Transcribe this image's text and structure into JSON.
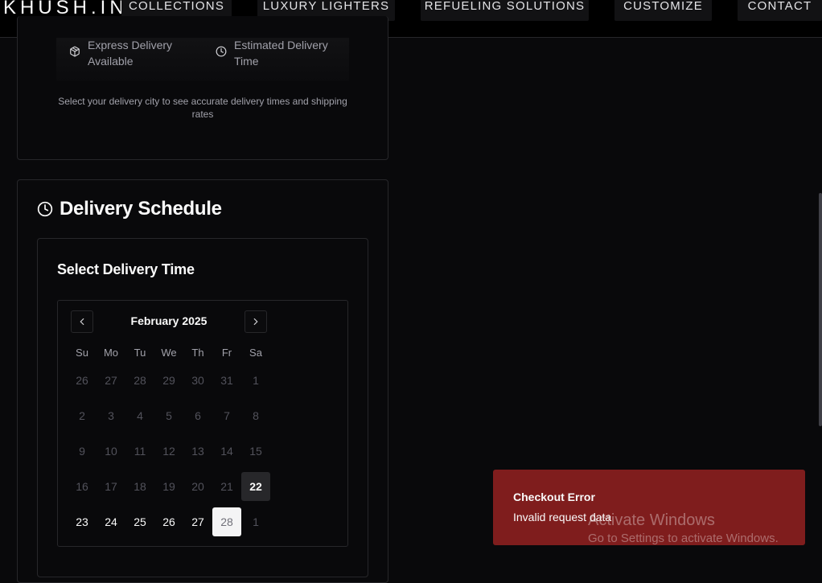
{
  "brand": "KHUSH.IN",
  "nav": [
    "COLLECTIONS",
    "LUXURY LIGHTERS",
    "REFUELING SOLUTIONS",
    "CUSTOMIZE",
    "CONTACT"
  ],
  "delivery_info": {
    "express": [
      "Express Delivery",
      "Available"
    ],
    "estimated": [
      "Estimated Delivery",
      "Time"
    ],
    "express_icon": "package-icon",
    "estimated_icon": "clock-icon",
    "hint": "Select your delivery city to see accurate delivery times and shipping rates"
  },
  "schedule": {
    "title": "Delivery Schedule",
    "title_icon": "clock-icon",
    "inner_title": "Select Delivery Time"
  },
  "calendar": {
    "month_label": "February 2025",
    "prev_icon": "chevron-left-icon",
    "next_icon": "chevron-right-icon",
    "weekdays": [
      "Su",
      "Mo",
      "Tu",
      "We",
      "Th",
      "Fr",
      "Sa"
    ],
    "weeks": [
      [
        "26",
        "27",
        "28",
        "29",
        "30",
        "31",
        "1"
      ],
      [
        "2",
        "3",
        "4",
        "5",
        "6",
        "7",
        "8"
      ],
      [
        "9",
        "10",
        "11",
        "12",
        "13",
        "14",
        "15"
      ],
      [
        "16",
        "17",
        "18",
        "19",
        "20",
        "21",
        "22"
      ],
      [
        "23",
        "24",
        "25",
        "26",
        "27",
        "28",
        "1"
      ]
    ],
    "today": "22",
    "selected": "28"
  },
  "toast": {
    "title": "Checkout Error",
    "message": "Invalid request data",
    "color": "#7f1d1d"
  },
  "watermark": {
    "line1": "Activate Windows",
    "line2": "Go to Settings to activate Windows."
  }
}
